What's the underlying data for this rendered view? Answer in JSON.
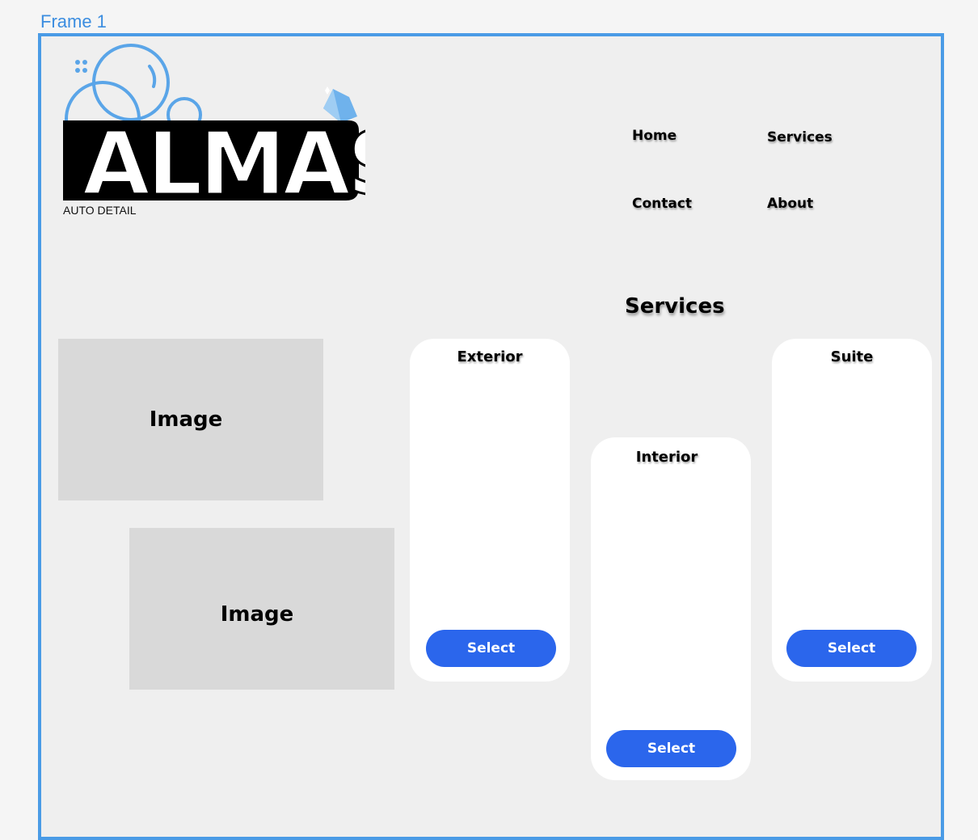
{
  "canvas": {
    "frame_label": "Frame 1"
  },
  "brand": {
    "logo_text": "ALMAS",
    "subtitle": "AUTO DETAIL"
  },
  "nav": {
    "home": "Home",
    "services": "Services",
    "contact": "Contact",
    "about": "About"
  },
  "section": {
    "title": "Services"
  },
  "images": {
    "image1": "Image",
    "image2": "Image"
  },
  "cards": {
    "exterior": {
      "title": "Exterior",
      "button": "Select"
    },
    "interior": {
      "title": "Interior",
      "button": "Select"
    },
    "suite": {
      "title": "Suite",
      "button": "Select"
    }
  },
  "colors": {
    "accent_button": "#2b66ec",
    "frame_border": "#4a9be6",
    "logo_bubbles": "#5aa5e8"
  }
}
